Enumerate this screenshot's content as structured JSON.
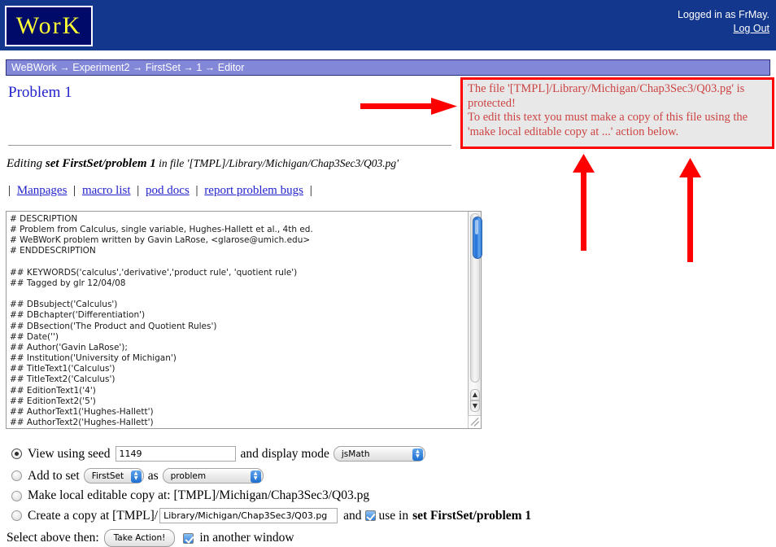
{
  "header": {
    "logo_text": "WorK",
    "logged_in_text": "Logged in as FrMay.",
    "logout_label": "Log Out"
  },
  "breadcrumb": {
    "text": "WeBWork → Experiment2 → FirstSet → 1 → Editor"
  },
  "page": {
    "title": "Problem 1"
  },
  "warning": {
    "line1": "The file '[TMPL]/Library/Michigan/Chap3Sec3/Q03.pg' is",
    "line2": "protected!",
    "line3": "To edit this text you must make a copy of this file using the",
    "line4": "'make local editable copy at ...' action below.",
    "border_color": "#ff0000",
    "text_color": "#cc4444",
    "background": "#e8e8e8"
  },
  "editing": {
    "prefix": "Editing ",
    "set_label": "set FirstSet/problem 1",
    "middle": " in file ",
    "file_path": "'[TMPL]/Library/Michigan/Chap3Sec3/Q03.pg'"
  },
  "links": {
    "separator": "|",
    "items": [
      {
        "label": "Manpages"
      },
      {
        "label": "macro list"
      },
      {
        "label": "pod docs"
      },
      {
        "label": "report problem bugs"
      }
    ]
  },
  "editor": {
    "content": "# DESCRIPTION\n# Problem from Calculus, single variable, Hughes-Hallett et al., 4th ed.\n# WeBWorK problem written by Gavin LaRose, <glarose@umich.edu>\n# ENDDESCRIPTION\n\n## KEYWORDS('calculus','derivative','product rule', 'quotient rule')\n## Tagged by glr 12/04/08\n\n## DBsubject('Calculus')\n## DBchapter('Differentiation')\n## DBsection('The Product and Quotient Rules')\n## Date('')\n## Author('Gavin LaRose');\n## Institution('University of Michigan')\n## TitleText1('Calculus')\n## TitleText2('Calculus')\n## EditionText1('4')\n## EditionText2('5')\n## AuthorText1('Hughes-Hallett')\n## AuthorText2('Hughes-Hallett')",
    "scroll_up_glyph": "▲",
    "scroll_down_glyph": "▼"
  },
  "form": {
    "view_seed_label": "View using seed",
    "seed_value": "1149",
    "display_mode_label": "and display mode",
    "display_mode_value": "jsMath",
    "add_to_set_label": "Add to set",
    "set_value": "FirstSet",
    "as_label": "as",
    "problem_value": "problem",
    "local_copy_label": "Make local editable copy at: [TMPL]/Michigan/Chap3Sec3/Q03.pg",
    "create_copy_label": "Create a copy at [TMPL]/",
    "copy_path_value": "Library/Michigan/Chap3Sec3/Q03.pg",
    "and_label": "and",
    "use_in_label": "use in",
    "use_in_target": "set FirstSet/problem 1",
    "select_above_label": "Select above then:",
    "take_action_label": "Take Action!",
    "another_window_label": "in another window",
    "stepper_up": "▲",
    "stepper_down": "▼"
  },
  "annotations": {
    "arrow_color": "#ff0000",
    "arrow_count": 3
  }
}
